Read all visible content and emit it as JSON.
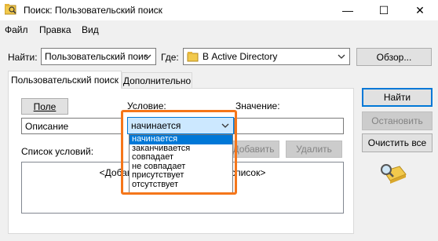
{
  "window": {
    "title": "Поиск: Пользовательский поиск",
    "minimize_glyph": "—",
    "maximize_glyph": "☐",
    "close_glyph": "✕"
  },
  "menu": [
    "Файл",
    "Правка",
    "Вид"
  ],
  "find_row": {
    "find_label": "Найти:",
    "find_value": "Пользовательский поис",
    "where_label": "Где:",
    "where_value": "В Active Directory",
    "browse_button": "Обзор..."
  },
  "tabs": [
    "Пользовательский поиск",
    "Дополнительно"
  ],
  "condition_form": {
    "field_button": "Поле",
    "condition_label": "Условие:",
    "value_label": "Значение:",
    "field_value": "Описание",
    "condition_value": "начинается",
    "condition_options": [
      "начинается",
      "заканчивается",
      "совпадает",
      "не совпадает",
      "присутствует",
      "отсутствует"
    ],
    "add_button": "Добавить",
    "remove_button": "Удалить",
    "conditions_list_label": "Список условий:",
    "conditions_placeholder": "<Добавьте критерии поиска в список>"
  },
  "side_buttons": {
    "find_now": "Найти",
    "stop": "Остановить",
    "clear_all": "Очистить все"
  },
  "colors": {
    "accent": "#0078d7",
    "highlight_border": "#f5761a",
    "combo_selected_bg": "#cce8ff"
  },
  "icons": {
    "app": "search-dialog-icon",
    "directory": "directory-icon",
    "search_illustration": "magnifier-search-icon"
  }
}
